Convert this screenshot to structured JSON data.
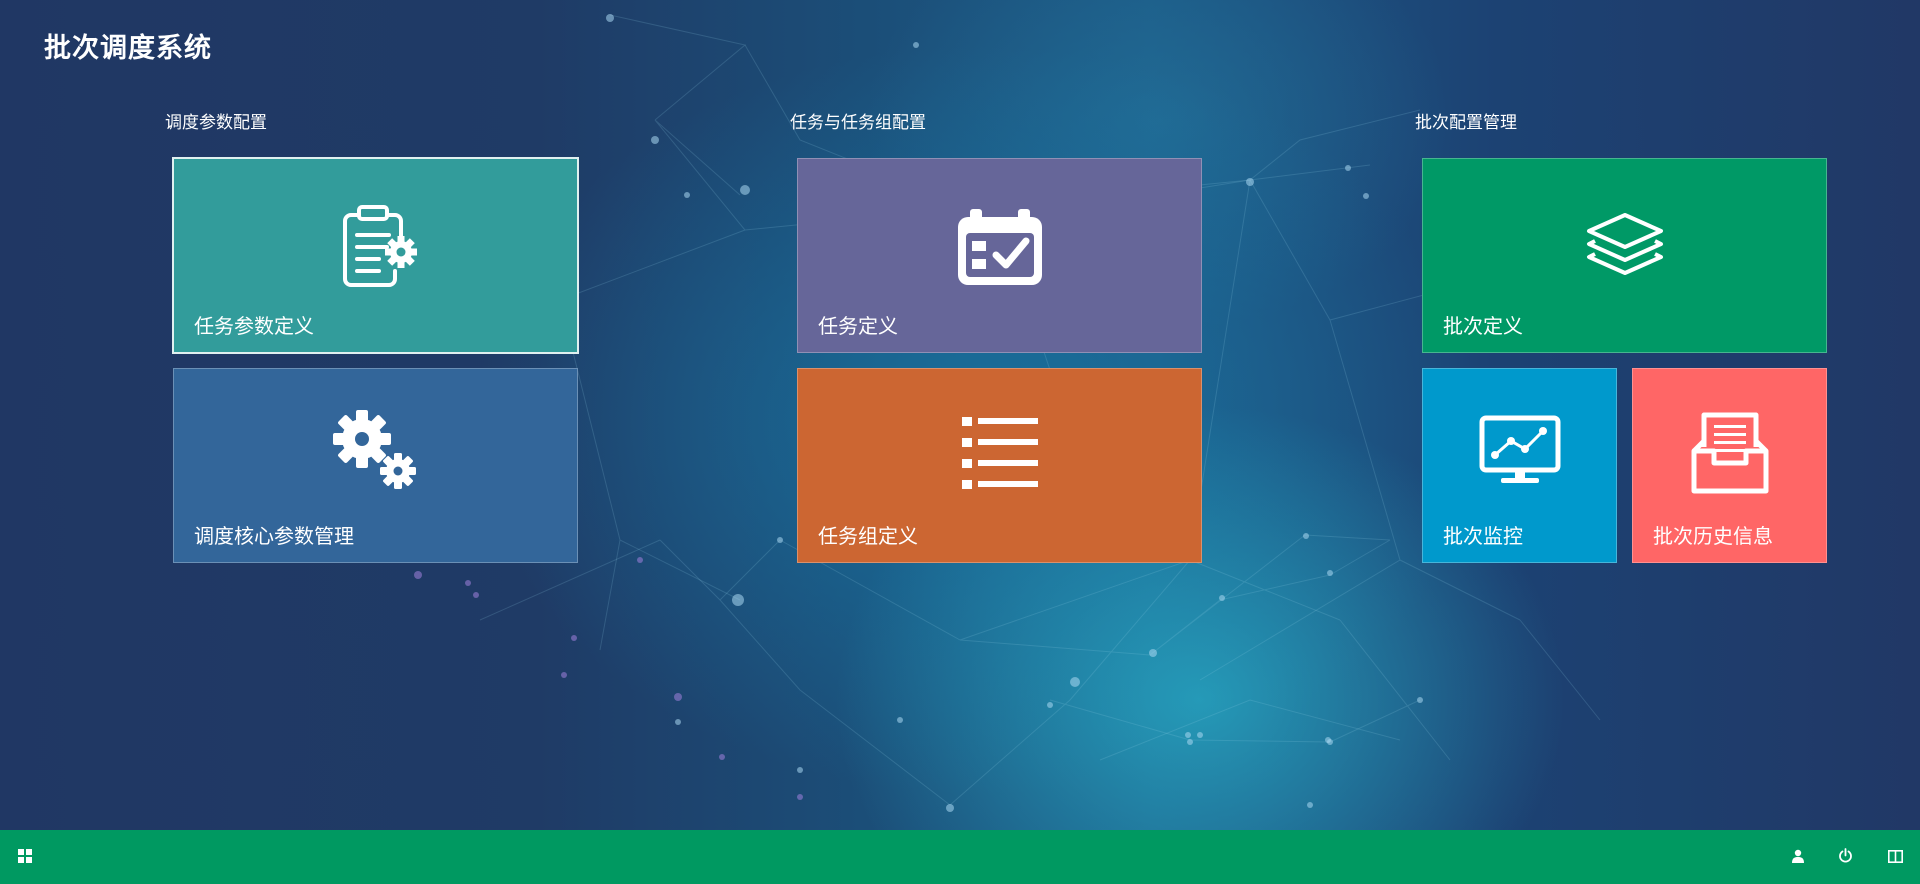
{
  "app": {
    "title": "批次调度系统"
  },
  "sections": [
    {
      "title": "调度参数配置"
    },
    {
      "title": "任务与任务组配置"
    },
    {
      "title": "批次配置管理"
    }
  ],
  "tiles": {
    "task_param_def": {
      "label": "任务参数定义",
      "color": "#329c9b",
      "icon": "clipboard-gear-icon"
    },
    "core_param_mgmt": {
      "label": "调度核心参数管理",
      "color": "#33669a",
      "icon": "gears-icon"
    },
    "task_def": {
      "label": "任务定义",
      "color": "#666699",
      "icon": "calendar-check-icon"
    },
    "task_group_def": {
      "label": "任务组定义",
      "color": "#cc6632",
      "icon": "list-icon"
    },
    "batch_def": {
      "label": "批次定义",
      "color": "#009966",
      "icon": "layers-icon"
    },
    "batch_monitor": {
      "label": "批次监控",
      "color": "#0099cc",
      "icon": "monitor-chart-icon"
    },
    "batch_history": {
      "label": "批次历史信息",
      "color": "#ff6666",
      "icon": "inbox-icon"
    }
  },
  "taskbar": {
    "color": "#009961",
    "start_icon": "windows-icon",
    "user_icon": "user-icon",
    "power_icon": "power-icon",
    "layout_icon": "layout-icon"
  }
}
